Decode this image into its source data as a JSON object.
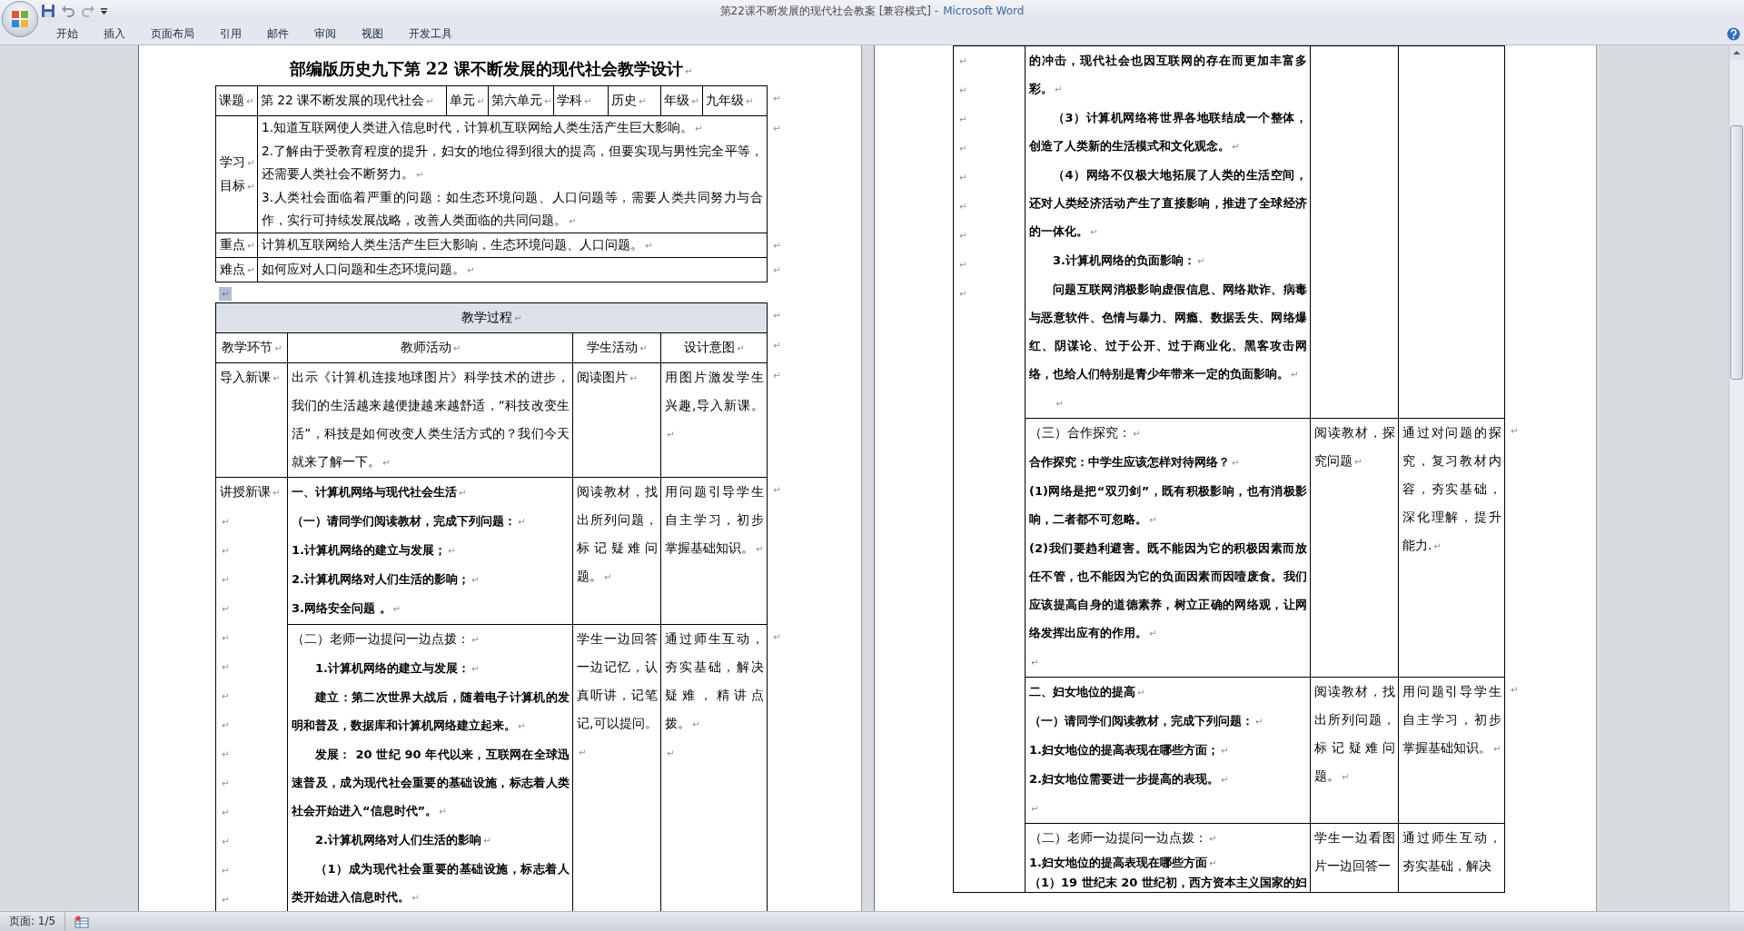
{
  "window": {
    "document_title": "第22课不断发展的现代社会教案 [兼容模式] -",
    "app_name": "Microsoft Word"
  },
  "ribbon_tabs": [
    "开始",
    "插入",
    "页面布局",
    "引用",
    "邮件",
    "审阅",
    "视图",
    "开发工具"
  ],
  "pages": [
    {
      "kind": "first",
      "title": {
        "text": "部编版历史九下第 22 课不断发展的现代社会教学设计",
        "mark": "↵"
      },
      "info_table": {
        "header_row": [
          {
            "text": "课题",
            "mark": "↵"
          },
          {
            "text": "第 22 课不断发展的现代社会",
            "mark": "↵"
          },
          {
            "text": "单元",
            "mark": "↵"
          },
          {
            "text": "第六单元",
            "mark": "↵"
          },
          {
            "text": "学科",
            "mark": "↵"
          },
          {
            "text": "历史",
            "mark": "↵"
          },
          {
            "text": "年级",
            "mark": "↵"
          },
          {
            "text": "九年级",
            "mark": "↵"
          }
        ],
        "header_end_mark": "↵",
        "rows": [
          {
            "label": [
              {
                "text": "学习",
                "mark": "↵"
              },
              {
                "text": "目标",
                "mark": "↵"
              }
            ],
            "content": [
              {
                "text": "1.知道互联网使人类进入信息时代，计算机互联网给人类生活产生巨大影响。",
                "mark": "↵"
              },
              {
                "text": "2.了解由于受教育程度的提升，妇女的地位得到很大的提高，但要实现与男性完全平等，还需要人类社会不断努力。",
                "mark": "↵"
              },
              {
                "text": "3.人类社会面临着严重的问题：如生态环境问题、人口问题等，需要人类共同努力与合作，实行可持续发展战略，改善人类面临的共同问题。",
                "mark": "↵"
              }
            ],
            "end_mark": "↵"
          },
          {
            "label": [
              {
                "text": "重点",
                "mark": "↵"
              }
            ],
            "content": [
              {
                "text": "计算机互联网给人类生活产生巨大影响，生态环境问题、人口问题。",
                "mark": "↵"
              }
            ],
            "end_mark": "↵"
          },
          {
            "label": [
              {
                "text": "难点",
                "mark": "↵"
              }
            ],
            "content": [
              {
                "text": "如何应对人口问题和生态环境问题。",
                "mark": "↵"
              }
            ],
            "end_mark": "↵"
          }
        ]
      },
      "gap_paragraph": {
        "mark": "↵",
        "selected": true
      },
      "process_table": {
        "caption": {
          "text": "教学过程",
          "mark": "↵"
        },
        "caption_end_mark": "↵",
        "columns": [
          {
            "text": "教学环节",
            "mark": "↵"
          },
          {
            "text": "教师活动",
            "mark": "↵"
          },
          {
            "text": "学生活动",
            "mark": "↵"
          },
          {
            "text": "设计意图",
            "mark": "↵"
          }
        ],
        "columns_end_mark": "↵",
        "sections": [
          {
            "stage": [
              {
                "text": "导入新课",
                "mark": "↵"
              }
            ],
            "parts": [
              {
                "teacher": [
                  {
                    "kind": "plain",
                    "text": "出示《计算机连接地球图片》科学技术的进步，我们的生活越来越便捷越来越舒适，“科技改变生活”，科技是如何改变人类生活方式的？我们今天就来了解一下。",
                    "mark": "↵"
                  }
                ],
                "student": [
                  {
                    "text": "阅读图片",
                    "mark": "↵"
                  }
                ],
                "design": [
                  {
                    "text": "用图片激发学生兴趣,导入新课。",
                    "mark": "↵"
                  }
                ],
                "end_mark": "↵"
              }
            ]
          },
          {
            "stage": [
              {
                "text": "讲授新课",
                "mark": "↵"
              },
              {
                "mark": "↵"
              },
              {
                "mark": "↵"
              },
              {
                "mark": "↵"
              },
              {
                "mark": "↵"
              },
              {
                "mark": "↵"
              },
              {
                "mark": "↵"
              },
              {
                "mark": "↵"
              },
              {
                "mark": "↵"
              },
              {
                "mark": "↵"
              },
              {
                "mark": "↵"
              },
              {
                "mark": "↵"
              },
              {
                "mark": "↵"
              },
              {
                "mark": "↵"
              },
              {
                "mark": "↵"
              }
            ],
            "parts": [
              {
                "teacher": [
                  {
                    "kind": "bold",
                    "text": "一、计算机网络与现代社会生活",
                    "mark": "↵"
                  },
                  {
                    "kind": "bold",
                    "text": "（一）请同学们阅读教材，完成下列问题：",
                    "mark": "↵"
                  },
                  {
                    "kind": "bold",
                    "text": "1.计算机网络的建立与发展；",
                    "mark": "↵"
                  },
                  {
                    "kind": "bold",
                    "text": "2.计算机网络对人们生活的影响；",
                    "mark": "↵"
                  },
                  {
                    "kind": "bold",
                    "text": "3.网络安全问题 。",
                    "mark": "↵"
                  }
                ],
                "student": [
                  {
                    "text": "阅读教材，找出所列问题，标记疑难问题。",
                    "mark": "↵"
                  }
                ],
                "design": [
                  {
                    "text": "用问题引导学生自主学习，初步掌握基础知识。",
                    "mark": "↵"
                  }
                ],
                "end_mark": "↵"
              },
              {
                "teacher": [
                  {
                    "kind": "plain",
                    "text": "（二）老师一边提问一边点拨：",
                    "mark": "↵"
                  },
                  {
                    "kind": "bold-indent",
                    "text": "1.计算机网络的建立与发展：",
                    "mark": "↵"
                  },
                  {
                    "kind": "bold-indent",
                    "text": "建立：第二次世界大战后，随着电子计算机的发明和普及，数据库和计算机网络建立起来。",
                    "mark": "↵"
                  },
                  {
                    "kind": "bold-indent",
                    "text": "发展： 20 世纪 90 年代以来，互联网在全球迅速普及，成为现代社会重要的基础设施，标志着人类社会开始进入“信息时代”。",
                    "mark": "↵"
                  },
                  {
                    "kind": "bold-indent",
                    "text": "2.计算机网络对人们生活的影响",
                    "mark": "↵"
                  },
                  {
                    "kind": "bold-indent",
                    "text": "（1）成为现代社会重要的基础设施，标志着人类开始进入信息时代。",
                    "mark": "↵"
                  }
                ],
                "student": [
                  {
                    "text": "学生一边回答一边记忆，认真听讲，记笔记,可以提问。",
                    "mark": "↵"
                  }
                ],
                "design": [
                  {
                    "text": "通过师生互动，夯实基础，解决疑难，精讲点拨。",
                    "mark": "↵"
                  },
                  {
                    "mark": "↵"
                  }
                ],
                "end_mark": "↵"
              }
            ]
          }
        ]
      }
    },
    {
      "kind": "continuation",
      "process_table": {
        "sections": [
          {
            "stage": [
              {
                "mark": "↵"
              },
              {
                "mark": "↵"
              },
              {
                "mark": "↵"
              },
              {
                "mark": "↵"
              },
              {
                "mark": "↵"
              },
              {
                "mark": "↵"
              },
              {
                "mark": "↵"
              },
              {
                "mark": "↵"
              },
              {
                "mark": "↵"
              }
            ],
            "parts": [
              {
                "teacher": [
                  {
                    "kind": "bold",
                    "text": "的冲击，现代社会也因互联网的存在而更加丰富多彩。",
                    "mark": "↵"
                  },
                  {
                    "kind": "bold-indent",
                    "text": "（3）计算机网络将世界各地联结成一个整体，创造了人类新的生活模式和文化观念。",
                    "mark": "↵"
                  },
                  {
                    "kind": "bold-indent",
                    "text": "（4）网络不仅极大地拓展了人类的生活空间，还对人类经济活动产生了直接影响，推进了全球经济的一体化。",
                    "mark": "↵"
                  },
                  {
                    "kind": "bold-indent",
                    "text": "3.计算机网络的负面影响：",
                    "mark": "↵"
                  },
                  {
                    "kind": "bold-indent",
                    "text": "问题互联网消极影响虚假信息、网络欺诈、病毒与恶意软件、色情与暴力、网瘾、数据丢失、网络爆红、阴谋论、过于公开、过于商业化、黑客攻击网络，也给人们特别是青少年带来一定的负面影响。",
                    "mark": "↵"
                  },
                  {
                    "kind": "indent",
                    "mark": "↵"
                  }
                ]
              },
              {
                "teacher": [
                  {
                    "kind": "plain",
                    "text": "（三）合作探究：",
                    "mark": "↵"
                  },
                  {
                    "kind": "bold",
                    "text": "合作探究：中学生应该怎样对待网络？",
                    "mark": "↵"
                  },
                  {
                    "kind": "bold",
                    "text": "(1)网络是把“双刃剑”，既有积极影响，也有消极影响，二者都不可忽略。",
                    "mark": "↵"
                  },
                  {
                    "kind": "bold",
                    "text": "(2)我们要趋利避害。既不能因为它的积极因素而放任不管，也不能因为它的负面因素而因噎废食。我们应该提高自身的道德素养，树立正确的网络观，让网络发挥出应有的作用。",
                    "mark": "↵"
                  },
                  {
                    "kind": "plain",
                    "mark": "↵"
                  }
                ],
                "student": [
                  {
                    "text": "阅读教材，探究问题",
                    "mark": "↵"
                  }
                ],
                "design": [
                  {
                    "text": "通过对问题的探究，复习教材内容，夯实基础，深化理解，提升能力.",
                    "mark": "↵"
                  }
                ],
                "end_mark": "↵"
              },
              {
                "teacher": [
                  {
                    "kind": "bold",
                    "text": "二、妇女地位的提高",
                    "mark": "↵"
                  },
                  {
                    "kind": "bold",
                    "text": "（一）请同学们阅读教材，完成下列问题：",
                    "mark": "↵"
                  },
                  {
                    "kind": "bold",
                    "text": "1.妇女地位的提高表现在哪些方面；",
                    "mark": "↵"
                  },
                  {
                    "kind": "bold",
                    "text": "2.妇女地位需要进一步提高的表现。",
                    "mark": "↵"
                  },
                  {
                    "kind": "plain",
                    "mark": "↵"
                  }
                ],
                "student": [
                  {
                    "text": "阅读教材，找出所列问题，标记疑难问题。",
                    "mark": "↵"
                  }
                ],
                "design": [
                  {
                    "text": "用问题引导学生自主学习，初步掌握基础知识。",
                    "mark": "↵"
                  }
                ],
                "end_mark": "↵"
              },
              {
                "teacher": [
                  {
                    "kind": "plain",
                    "text": "（二）老师一边提问一边点拨：",
                    "mark": "↵"
                  },
                  {
                    "kind": "bold-tight",
                    "text": "1.妇女地位的提高表现在哪些方面",
                    "mark": "↵"
                  },
                  {
                    "kind": "bold-tight",
                    "text": "（1）19 世纪末 20 世纪初，西方资本主义国家的妇"
                  }
                ],
                "student": [
                  {
                    "text": "学生一边看图片一边回答一"
                  }
                ],
                "design": [
                  {
                    "text": "通过师生互动，夯实基础，解决"
                  }
                ]
              }
            ]
          }
        ]
      }
    }
  ],
  "status_bar": {
    "page": "页面: 1/5"
  }
}
